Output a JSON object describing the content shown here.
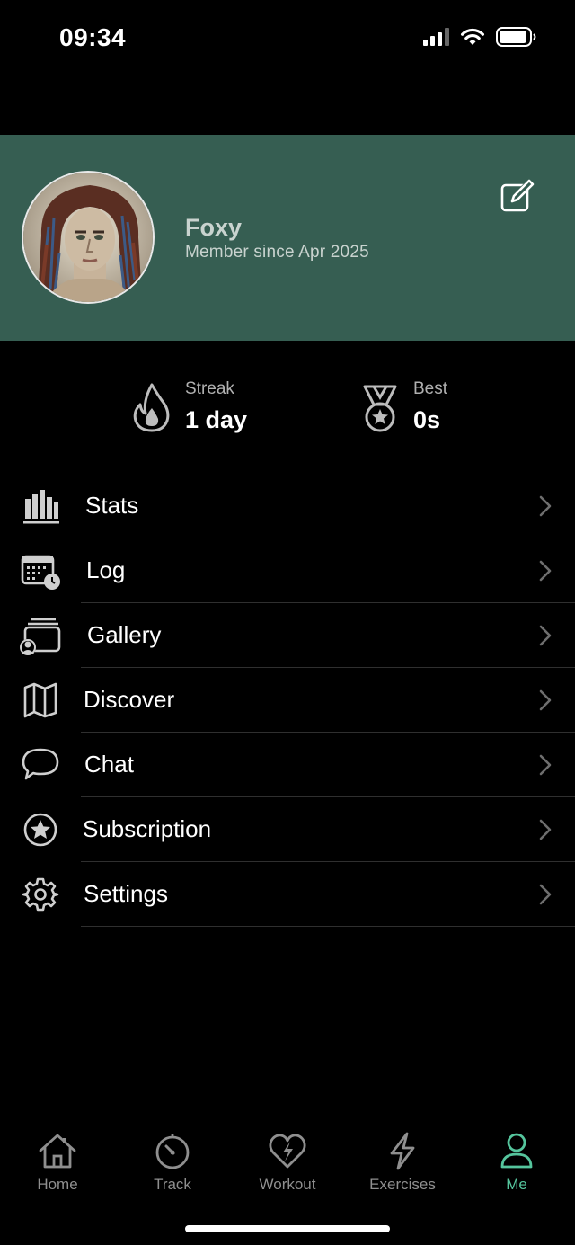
{
  "status_bar": {
    "time": "09:34"
  },
  "profile": {
    "name": "Foxy",
    "member_since": "Member since Apr 2025",
    "header_color": "#365e52"
  },
  "stats": {
    "streak": {
      "label": "Streak",
      "value": "1 day",
      "icon": "flame-icon"
    },
    "best": {
      "label": "Best",
      "value": "0s",
      "icon": "medal-icon"
    }
  },
  "menu": {
    "items": [
      {
        "label": "Stats",
        "icon": "bar-chart-icon"
      },
      {
        "label": "Log",
        "icon": "calendar-clock-icon"
      },
      {
        "label": "Gallery",
        "icon": "gallery-icon"
      },
      {
        "label": "Discover",
        "icon": "map-icon"
      },
      {
        "label": "Chat",
        "icon": "chat-bubble-icon"
      },
      {
        "label": "Subscription",
        "icon": "star-circle-icon"
      },
      {
        "label": "Settings",
        "icon": "gear-icon"
      }
    ]
  },
  "tabs": {
    "items": [
      {
        "label": "Home",
        "icon": "house-icon"
      },
      {
        "label": "Track",
        "icon": "stopwatch-icon"
      },
      {
        "label": "Workout",
        "icon": "heart-bolt-icon"
      },
      {
        "label": "Exercises",
        "icon": "lightning-icon"
      },
      {
        "label": "Me",
        "icon": "person-icon"
      }
    ],
    "active": "Me",
    "active_color": "#55c59d",
    "inactive_color": "#8f8f8f"
  }
}
